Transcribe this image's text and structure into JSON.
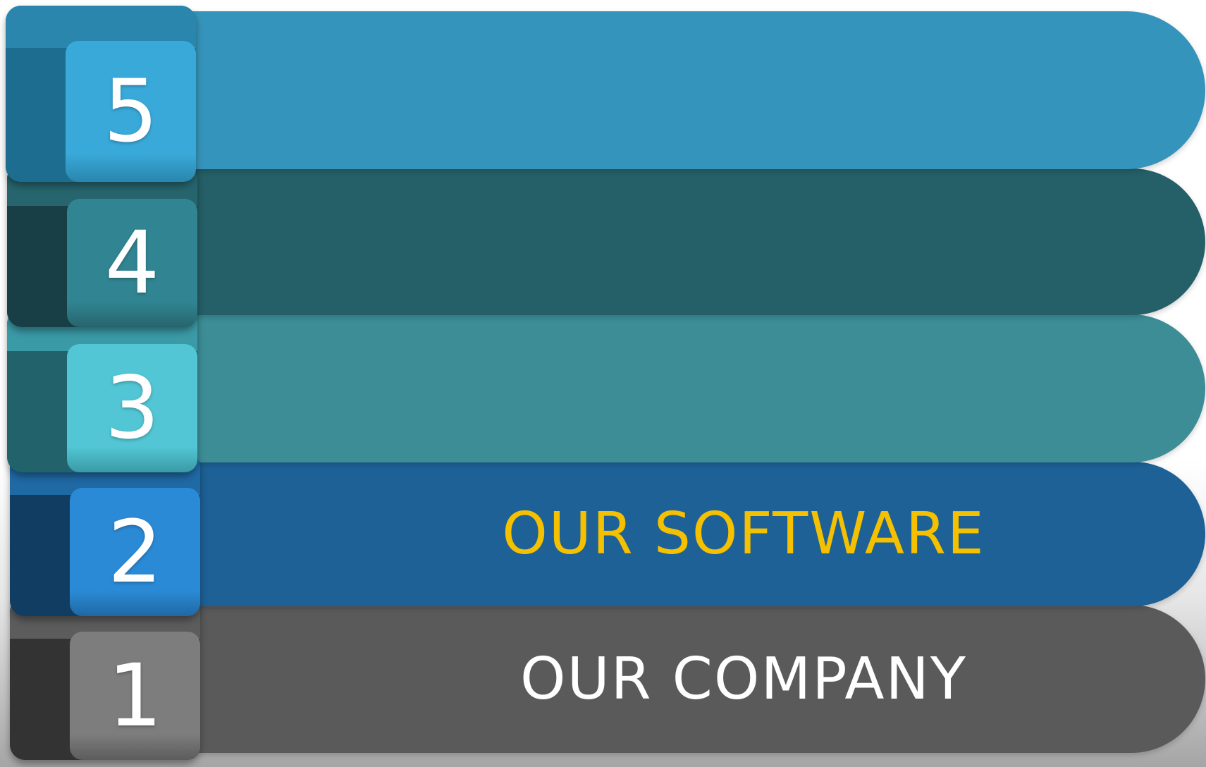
{
  "steps": [
    {
      "number": "5",
      "label": "",
      "bar_color": "#3594bb",
      "label_color": "#ffffff",
      "cube_front": "#39a9d9",
      "cube_side": "#1c6d8f",
      "cube_top": "#2a86ad"
    },
    {
      "number": "4",
      "label": "",
      "bar_color": "#255f67",
      "label_color": "#ffffff",
      "cube_front": "#318592",
      "cube_side": "#173f45",
      "cube_top": "#27656e"
    },
    {
      "number": "3",
      "label": "",
      "bar_color": "#3d8d96",
      "label_color": "#ffffff",
      "cube_front": "#52c6d4",
      "cube_side": "#22626a",
      "cube_top": "#3a9aa6"
    },
    {
      "number": "2",
      "label": "OUR SOFTWARE",
      "bar_color": "#1d6196",
      "label_color": "#f5c000",
      "cube_front": "#2b8ad6",
      "cube_side": "#103d61",
      "cube_top": "#1f69a4"
    },
    {
      "number": "1",
      "label": "OUR COMPANY",
      "bar_color": "#5a5a5a",
      "label_color": "#ffffff",
      "cube_front": "#7d7d7d",
      "cube_side": "#333333",
      "cube_top": "#5c5c5c"
    }
  ]
}
